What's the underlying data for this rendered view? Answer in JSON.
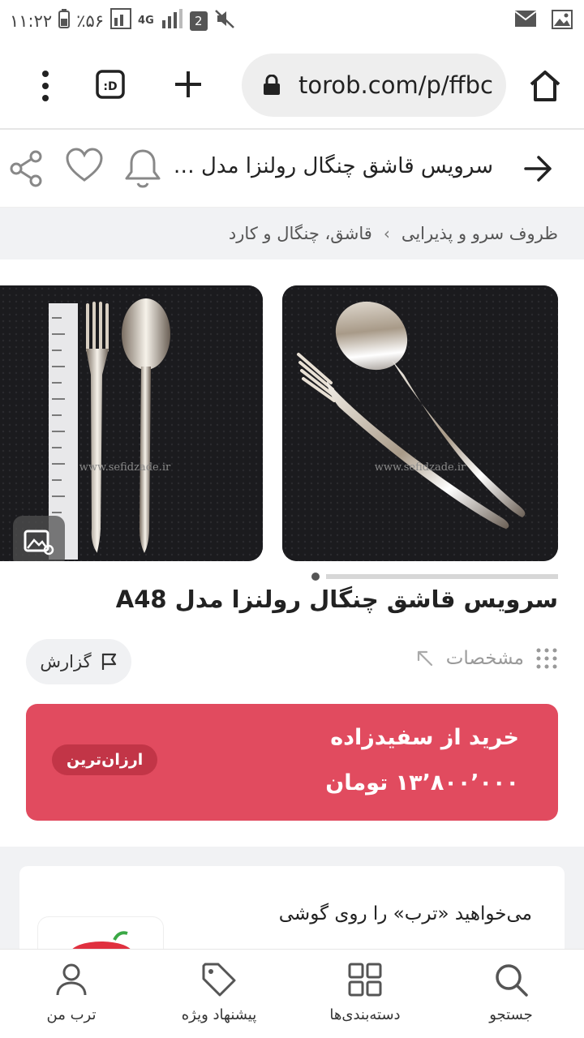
{
  "status_bar": {
    "time": "۱۱:۲۲",
    "battery": "٪۵۶",
    "network": "4G",
    "sim_badge": "2",
    "icons": [
      "battery-icon",
      "data-icon",
      "signal-icon",
      "sim-icon",
      "mute-icon",
      "mail-icon",
      "image-icon"
    ]
  },
  "browser": {
    "url": "torob.com/p/ffbc",
    "icons": [
      "menu-icon",
      "tabs-icon",
      "plus-icon",
      "lock-icon",
      "home-icon"
    ]
  },
  "header": {
    "title": "سرویس قاشق چنگال رولنزا مدل A48",
    "icons": [
      "share-icon",
      "heart-icon",
      "bell-icon",
      "arrow-right-icon"
    ]
  },
  "breadcrumb": {
    "items": [
      "ظروف سرو و پذیرایی",
      "قاشق، چنگال و کارد"
    ],
    "separator": "›"
  },
  "gallery": {
    "watermark_1": "www.sefidzade.ir",
    "watermark_2": "www.sefidzade.ir",
    "gallery_icon": "gallery-icon"
  },
  "product": {
    "title": "سرویس قاشق چنگال رولنزا مدل A48"
  },
  "actions": {
    "report_label": "گزارش",
    "specs_label": "مشخصات"
  },
  "buy": {
    "label": "خرید از سفیدزاده",
    "price": "۱۳٬۸۰۰٬۰۰۰ تومان",
    "badge": "ارزان‌ترین",
    "color": "#e14b5f"
  },
  "promo": {
    "text": "می‌خواهید «ترب» را روی گوشی"
  },
  "bottom_nav": {
    "search": "جستجو",
    "categories": "دسته‌بندی‌ها",
    "offers": "پیشنهاد ویژه",
    "my_torob": "ترب من"
  }
}
